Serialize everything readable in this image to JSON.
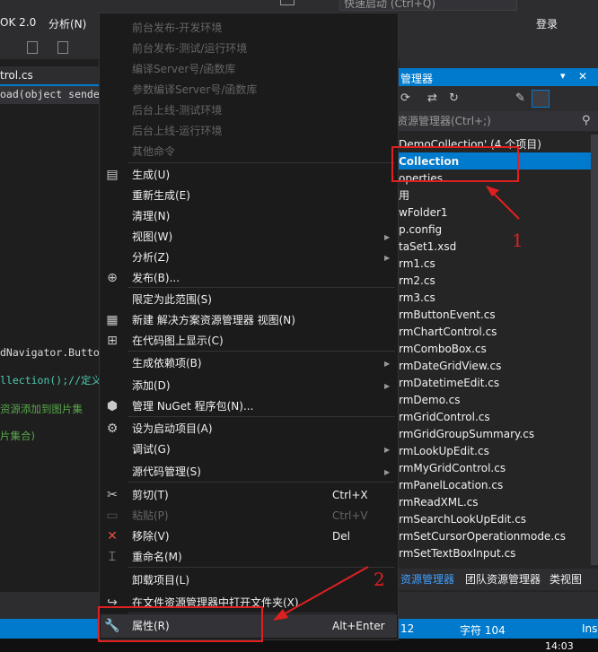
{
  "topbar": {
    "menu_left_a": "OK 2.0",
    "menu_left_b": "分析(N)",
    "quick_search": "快速启动 (Ctrl+Q)",
    "login": "登录"
  },
  "editor": {
    "tab_label": "trol.cs",
    "lines": [
      "oad(object sender,",
      "dNavigator.Butto",
      "llection();//定义",
      "资源添加到图片集",
      "片集合)"
    ]
  },
  "solution_explorer": {
    "title": "管理器",
    "search_placeholder": "资源管理器(Ctrl+;)",
    "items": [
      "DemoCollection' (4 个项目)",
      "Collection",
      "operties",
      "用",
      "wFolder1",
      "p.config",
      "taSet1.xsd",
      "rm1.cs",
      "rm2.cs",
      "rm3.cs",
      "rmButtonEvent.cs",
      "rmChartControl.cs",
      "rmComboBox.cs",
      "rmDateGridView.cs",
      "rmDatetimeEdit.cs",
      "rmDemo.cs",
      "rmGridControl.cs",
      "rmGridGroupSummary.cs",
      "rmLookUpEdit.cs",
      "rmMyGridControl.cs",
      "rmPanelLocation.cs",
      "rmReadXML.cs",
      "rmSearchLookUpEdit.cs",
      "rmSetCursorOperationmode.cs",
      "rmSetTextBoxInput.cs"
    ],
    "tabs": [
      "资源管理器",
      "团队资源管理器",
      "类视图"
    ]
  },
  "status": {
    "col": "12",
    "char": "字符 104",
    "ins": "Ins",
    "time": "14:03"
  },
  "context_menu": {
    "items": [
      {
        "label": "前台发布-开发环境",
        "enabled": false
      },
      {
        "label": "前台发布-测试/运行环境",
        "enabled": false
      },
      {
        "label": "编译Server号/函数库",
        "enabled": false
      },
      {
        "label": "参数编译Server号/函数库",
        "enabled": false
      },
      {
        "label": "后台上线-测试环境",
        "enabled": false
      },
      {
        "label": "后台上线-运行环境",
        "enabled": false
      },
      {
        "label": "其他命令",
        "enabled": false
      },
      {
        "label": "生成(U)",
        "icon": "build-icon"
      },
      {
        "label": "重新生成(E)"
      },
      {
        "label": "清理(N)"
      },
      {
        "label": "视图(W)",
        "submenu": true
      },
      {
        "label": "分析(Z)",
        "submenu": true
      },
      {
        "label": "发布(B)...",
        "icon": "publish-icon"
      },
      {
        "label": "限定为此范围(S)"
      },
      {
        "label": "新建 解决方案资源管理器 视图(N)",
        "icon": "new-view-icon"
      },
      {
        "label": "在代码图上显示(C)",
        "icon": "code-map-icon"
      },
      {
        "label": "生成依赖项(B)",
        "submenu": true
      },
      {
        "label": "添加(D)",
        "submenu": true
      },
      {
        "label": "管理 NuGet 程序包(N)...",
        "icon": "nuget-icon"
      },
      {
        "label": "设为启动项目(A)",
        "icon": "gear-icon"
      },
      {
        "label": "调试(G)",
        "submenu": true
      },
      {
        "label": "源代码管理(S)",
        "submenu": true
      },
      {
        "label": "剪切(T)",
        "shortcut": "Ctrl+X",
        "icon": "cut-icon"
      },
      {
        "label": "粘贴(P)",
        "shortcut": "Ctrl+V",
        "enabled": false,
        "icon": "paste-icon"
      },
      {
        "label": "移除(V)",
        "shortcut": "Del",
        "icon": "remove-icon"
      },
      {
        "label": "重命名(M)",
        "icon": "rename-icon"
      },
      {
        "label": "卸载项目(L)"
      },
      {
        "label": "在文件资源管理器中打开文件夹(X)",
        "icon": "open-folder-icon"
      },
      {
        "label": "属性(R)",
        "shortcut": "Alt+Enter",
        "icon": "wrench-icon"
      }
    ]
  },
  "annotations": {
    "label1": "1",
    "label2": "2",
    "color": "#e02020"
  }
}
